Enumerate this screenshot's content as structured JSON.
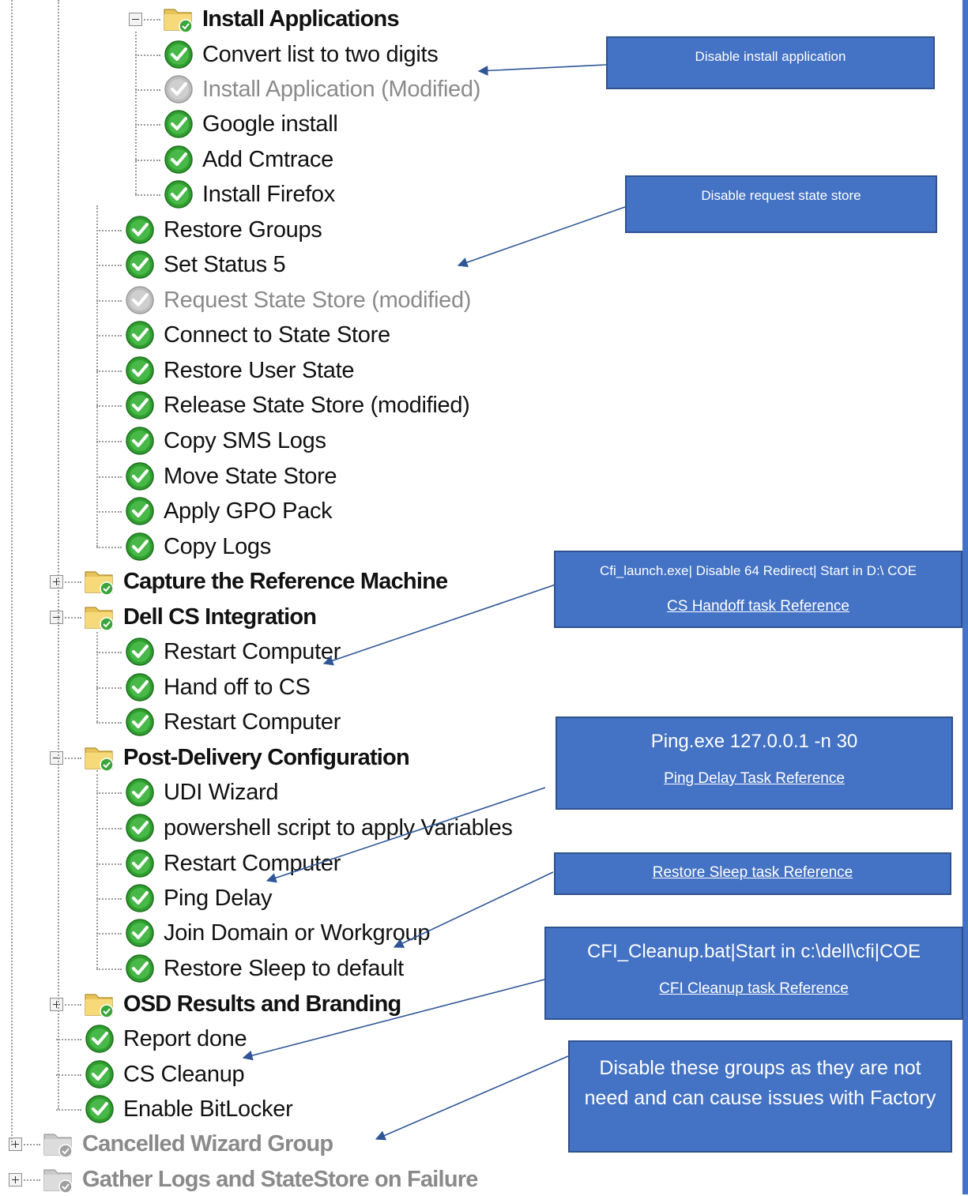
{
  "tree": {
    "items": [
      {
        "label": "Install Applications",
        "type": "group",
        "state": "enabled",
        "expander": "minus"
      },
      {
        "label": "Convert list to two digits",
        "type": "step",
        "state": "enabled"
      },
      {
        "label": "Install Application (Modified)",
        "type": "step",
        "state": "disabled"
      },
      {
        "label": "Google install",
        "type": "step",
        "state": "enabled"
      },
      {
        "label": "Add Cmtrace",
        "type": "step",
        "state": "enabled"
      },
      {
        "label": "Install Firefox",
        "type": "step",
        "state": "enabled"
      },
      {
        "label": "Restore Groups",
        "type": "step",
        "state": "enabled"
      },
      {
        "label": "Set Status 5",
        "type": "step",
        "state": "enabled"
      },
      {
        "label": "Request State Store (modified)",
        "type": "step",
        "state": "disabled"
      },
      {
        "label": "Connect to State Store",
        "type": "step",
        "state": "enabled"
      },
      {
        "label": "Restore User State",
        "type": "step",
        "state": "enabled"
      },
      {
        "label": "Release State Store (modified)",
        "type": "step",
        "state": "enabled"
      },
      {
        "label": "Copy SMS Logs",
        "type": "step",
        "state": "enabled"
      },
      {
        "label": "Move State Store",
        "type": "step",
        "state": "enabled"
      },
      {
        "label": "Apply GPO Pack",
        "type": "step",
        "state": "enabled"
      },
      {
        "label": "Copy Logs",
        "type": "step",
        "state": "enabled"
      },
      {
        "label": "Capture the Reference Machine",
        "type": "group",
        "state": "enabled",
        "expander": "plus"
      },
      {
        "label": "Dell CS Integration",
        "type": "group",
        "state": "enabled",
        "expander": "minus"
      },
      {
        "label": "Restart Computer",
        "type": "step",
        "state": "enabled"
      },
      {
        "label": "Hand off to CS",
        "type": "step",
        "state": "enabled"
      },
      {
        "label": "Restart Computer",
        "type": "step",
        "state": "enabled"
      },
      {
        "label": "Post-Delivery Configuration",
        "type": "group",
        "state": "enabled",
        "expander": "minus"
      },
      {
        "label": "UDI Wizard",
        "type": "step",
        "state": "enabled"
      },
      {
        "label": "powershell script to apply Variables",
        "type": "step",
        "state": "enabled"
      },
      {
        "label": "Restart Computer",
        "type": "step",
        "state": "enabled"
      },
      {
        "label": "Ping Delay",
        "type": "step",
        "state": "enabled"
      },
      {
        "label": "Join Domain or Workgroup",
        "type": "step",
        "state": "enabled"
      },
      {
        "label": "Restore Sleep to default",
        "type": "step",
        "state": "enabled"
      },
      {
        "label": "OSD Results and Branding",
        "type": "group",
        "state": "enabled",
        "expander": "plus"
      },
      {
        "label": "Report done",
        "type": "step",
        "state": "enabled"
      },
      {
        "label": "CS Cleanup",
        "type": "step",
        "state": "enabled"
      },
      {
        "label": "Enable BitLocker",
        "type": "step",
        "state": "enabled"
      },
      {
        "label": "Cancelled Wizard Group",
        "type": "group",
        "state": "disabled",
        "expander": "plus"
      },
      {
        "label": "Gather Logs and StateStore on Failure",
        "type": "group",
        "state": "disabled",
        "expander": "plus"
      }
    ]
  },
  "callouts": {
    "disable_install": {
      "text": "Disable install application"
    },
    "disable_request": {
      "text": "Disable request state store"
    },
    "cs_handoff": {
      "text": "Cfi_launch.exe| Disable 64 Redirect| Start in D:\\ COE",
      "link": "CS Handoff task Reference"
    },
    "ping": {
      "text": "Ping.exe 127.0.0.1 -n 30",
      "link": "Ping Delay Task Reference"
    },
    "restore_sleep": {
      "link": "Restore Sleep task Reference"
    },
    "cleanup": {
      "text": "CFI_Cleanup.bat|Start in c:\\dell\\cfi|COE",
      "link": "CFI Cleanup task Reference"
    },
    "disable_groups": {
      "text": "Disable these groups as they are not need and can cause issues with Factory"
    }
  },
  "colors": {
    "callout_fill": "#4472c4",
    "callout_border": "#2f528f",
    "enabled_icon": "#2fa12f",
    "disabled_icon": "#b5b5b5",
    "disabled_text": "#8a8a8a"
  }
}
